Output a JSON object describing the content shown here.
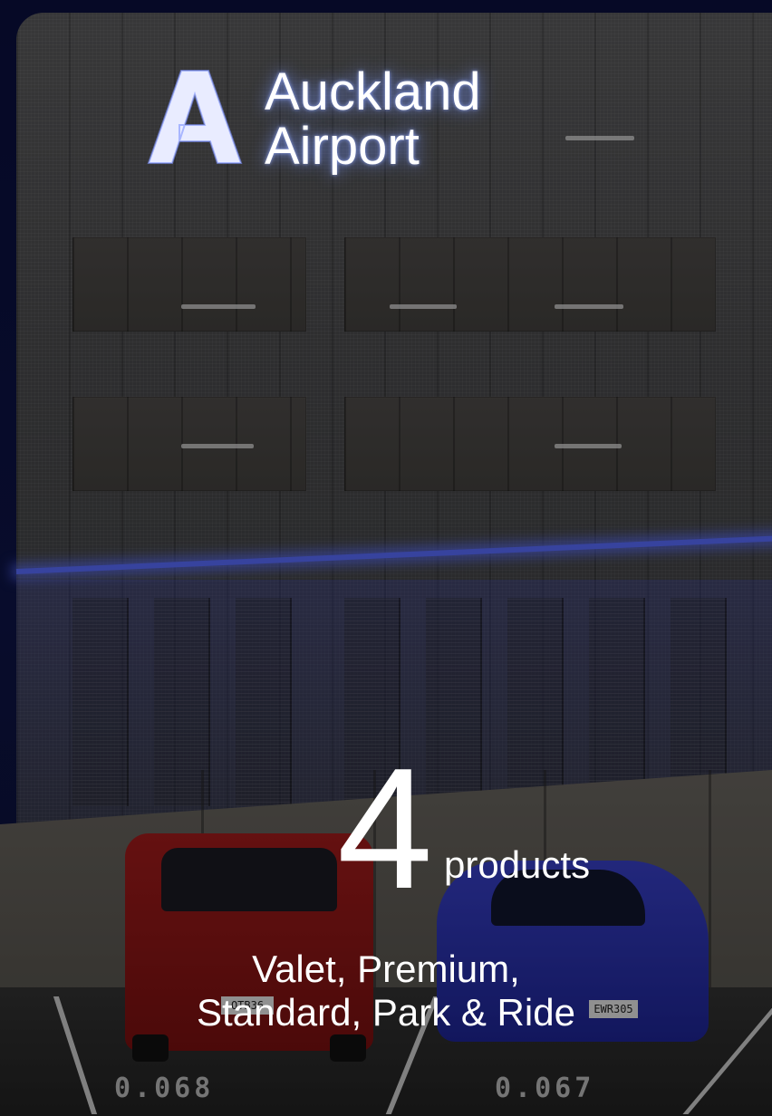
{
  "brand": {
    "logo_line1": "Auckland",
    "logo_line2": "Airport"
  },
  "stat": {
    "number": "4",
    "unit": "products",
    "description_line1": "Valet, Premium,",
    "description_line2": "Standard, Park & Ride"
  },
  "background": {
    "plate_left": "OTB36",
    "plate_right": "EWR305",
    "ground_marking_left": "0.068",
    "ground_marking_right": "0.067"
  },
  "colors": {
    "accent_glow": "#5a6cff",
    "text": "#ffffff"
  }
}
